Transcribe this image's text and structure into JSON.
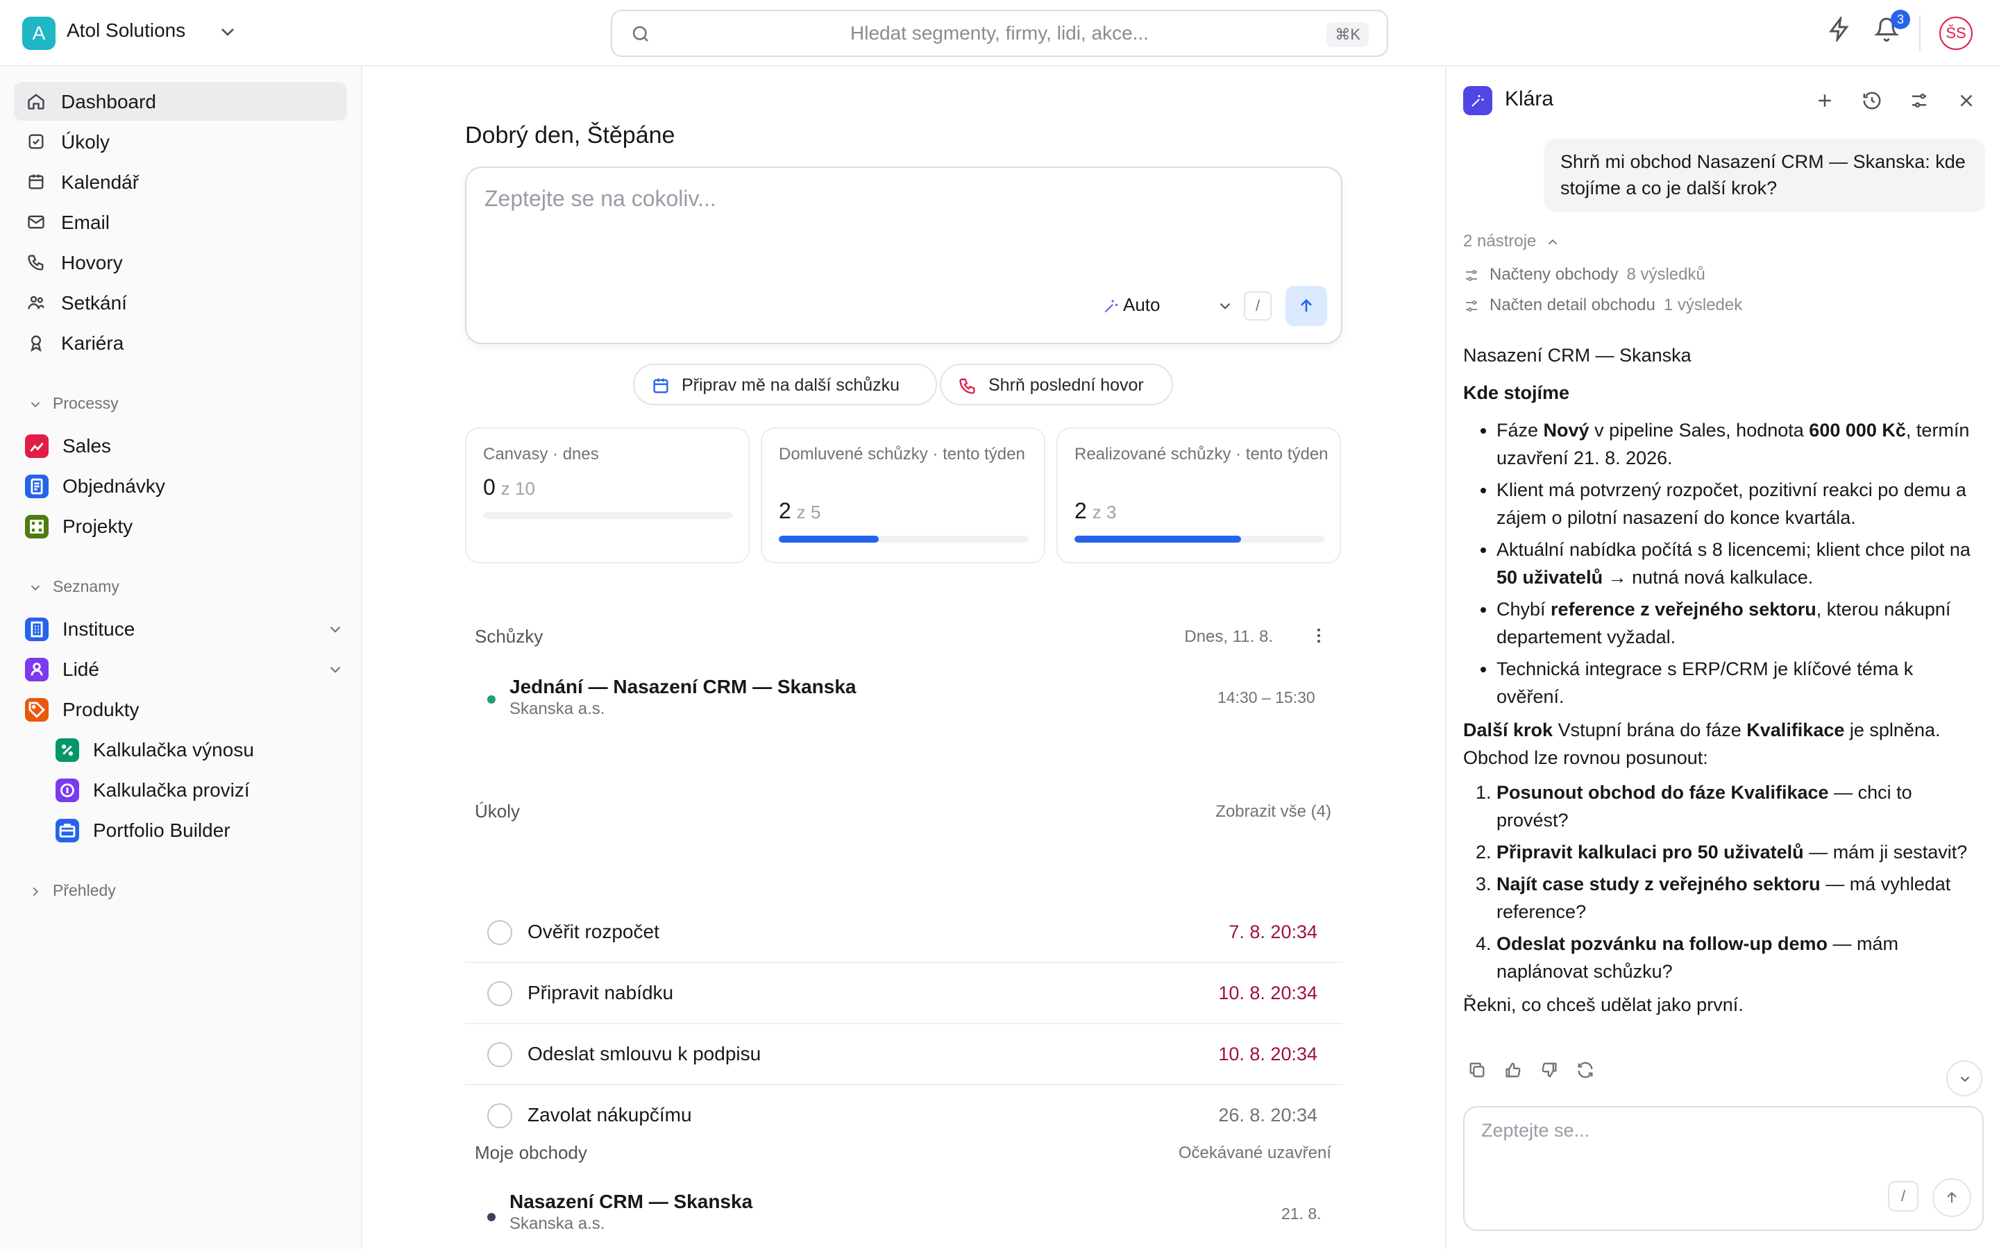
{
  "topbar": {
    "logo_letter": "A",
    "org_name": "Atol Solutions",
    "search_placeholder": "Hledat segmenty, firmy, lidi, akce...",
    "search_shortcut": "⌘K",
    "notification_count": "3",
    "user_initials": "ŠS"
  },
  "sidebar": {
    "nav": [
      {
        "label": "Dashboard",
        "icon": "home-icon"
      },
      {
        "label": "Úkoly",
        "icon": "checkbox-icon"
      },
      {
        "label": "Kalendář",
        "icon": "calendar-icon"
      },
      {
        "label": "Email",
        "icon": "mail-icon"
      },
      {
        "label": "Hovory",
        "icon": "phone-icon"
      },
      {
        "label": "Setkání",
        "icon": "users-icon"
      },
      {
        "label": "Kariéra",
        "icon": "award-icon"
      }
    ],
    "processes_title": "Processy",
    "processes": [
      {
        "label": "Sales",
        "color": "#e11d48"
      },
      {
        "label": "Objednávky",
        "color": "#2563eb"
      },
      {
        "label": "Projekty",
        "color": "#4d7c0f"
      }
    ],
    "lists_title": "Seznamy",
    "lists": [
      {
        "label": "Instituce",
        "color": "#2563eb"
      },
      {
        "label": "Lidé",
        "color": "#7c3aed"
      },
      {
        "label": "Produkty",
        "color": "#ea580c"
      }
    ],
    "products": [
      {
        "label": "Kalkulačka výnosu",
        "color": "#059669"
      },
      {
        "label": "Kalkulačka provizí",
        "color": "#7c3aed"
      },
      {
        "label": "Portfolio Builder",
        "color": "#2563eb"
      }
    ],
    "overviews_title": "Přehledy"
  },
  "main": {
    "greeting": "Dobrý den, Štěpáne",
    "ask_placeholder": "Zeptejte se na cokoliv...",
    "mode_label": "Auto",
    "slash_label": "/",
    "chips": [
      {
        "label": "Připrav mě na další schůzku",
        "icon": "calendar-icon"
      },
      {
        "label": "Shrň poslední hovor",
        "icon": "phone-icon"
      }
    ],
    "cards": [
      {
        "title": "Canvasy · dnes",
        "value": "0",
        "of": "z 10",
        "progress": 0
      },
      {
        "title": "Domluvené schůzky · tento týden",
        "value": "2",
        "of": "z 5",
        "progress": 0.4
      },
      {
        "title": "Realizované schůzky · tento týden",
        "value": "2",
        "of": "z 3",
        "progress": 0.667
      }
    ],
    "meetings": {
      "title": "Schůzky",
      "date": "Dnes, 11. 8.",
      "items": [
        {
          "title": "Jednání — Nasazení CRM — Skanska",
          "company": "Skanska a.s.",
          "time": "14:30 – 15:30"
        }
      ]
    },
    "tasks": {
      "title": "Úkoly",
      "show_all": "Zobrazit vše (4)",
      "items": [
        {
          "label": "Ověřit rozpočet",
          "due": "7. 8. 20:34"
        },
        {
          "label": "Připravit nabídku",
          "due": "10. 8. 20:34"
        },
        {
          "label": "Odeslat smlouvu k podpisu",
          "due": "10. 8. 20:34"
        },
        {
          "label": "Zavolat nákupčímu",
          "due": "26. 8. 20:34"
        }
      ]
    },
    "deals": {
      "title": "Moje obchody",
      "right_label": "Očekávané uzavření",
      "items": [
        {
          "title": "Nasazení CRM — Skanska",
          "company": "Skanska a.s.",
          "close": "21. 8."
        }
      ]
    }
  },
  "assistant": {
    "name": "Klára",
    "user_message": "Shrň mi obchod Nasazení CRM — Skanska: kde stojíme a co je další krok?",
    "tools_label": "2 nástroje",
    "tools": [
      {
        "label": "Načteny obchody",
        "count": "8 výsledků"
      },
      {
        "label": "Načten detail obchodu",
        "count": "1 výsledek"
      }
    ],
    "deal_name": "Nasazení CRM — Skanska",
    "where_title": "Kde stojíme",
    "b1": {
      "t1": "Fáze ",
      "s1": "Nový",
      "t2": " v pipeline Sales, hodnota ",
      "s2": "600 000 Kč",
      "t3": ", termín uzavření 21. 8. 2026."
    },
    "b2": "Klient má potvrzený rozpočet, pozitivní reakci po demu a zájem o pilotní nasazení do konce kvartála.",
    "b3": {
      "t1": "Aktuální nabídka počítá s 8 licencemi; klient chce pilot na ",
      "s1": "50 uživatelů",
      "t2": " → nutná nová kalkulace."
    },
    "b4": {
      "t1": "Chybí ",
      "s1": "reference z veřejného sektoru",
      "t2": ", kterou nákupní departement vyžadal."
    },
    "b5": "Technická integrace s ERP/CRM je klíčové téma k ověření.",
    "next": {
      "s1": "Další krok",
      "t1": " Vstupní brána do fáze ",
      "s2": "Kvalifikace",
      "t2": " je splněna. Obchod lze rovnou posunout:"
    },
    "steps": [
      {
        "s": "Posunout obchod do fáze Kvalifikace",
        "t": " — chci to provést?"
      },
      {
        "s": "Připravit kalkulaci pro 50 uživatelů",
        "t": " — mám ji sestavit?"
      },
      {
        "s": "Najít case study z veřejného sektoru",
        "t": " — má vyhledat reference?"
      },
      {
        "s": "Odeslat pozvánku na follow-up demo",
        "t": " — mám naplánovat schůzku?"
      }
    ],
    "closing": "Řekni, co chceš udělat jako první.",
    "input_placeholder": "Zeptejte se...",
    "slash_label": "/"
  }
}
